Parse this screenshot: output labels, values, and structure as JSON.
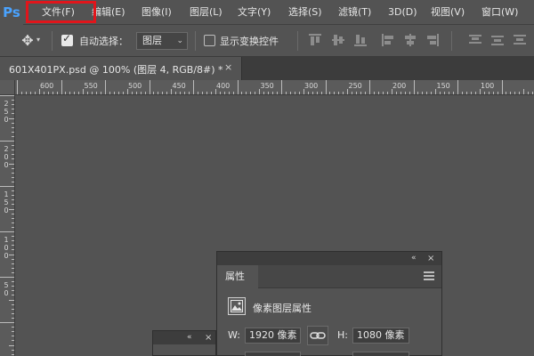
{
  "app": {
    "logo": "Ps"
  },
  "menubar": {
    "items": [
      {
        "label": "文件(F)"
      },
      {
        "label": "编辑(E)"
      },
      {
        "label": "图像(I)"
      },
      {
        "label": "图层(L)"
      },
      {
        "label": "文字(Y)"
      },
      {
        "label": "选择(S)"
      },
      {
        "label": "滤镜(T)"
      },
      {
        "label": "3D(D)"
      },
      {
        "label": "视图(V)"
      },
      {
        "label": "窗口(W)"
      }
    ],
    "highlight_color": "#e1151b"
  },
  "options": {
    "move_tool_icon": "move-icon",
    "auto_select_label": "自动选择：",
    "auto_select_checked": true,
    "target_select": "图层",
    "show_transform_label": "显示变换控件",
    "show_transform_checked": false
  },
  "document": {
    "tab_title": "601X401PX.psd @ 100% (图层 4, RGB/8#) *",
    "close_symbol": "×"
  },
  "rulers": {
    "top_labels": [
      "600",
      "550",
      "500",
      "450",
      "400",
      "350",
      "300",
      "250",
      "200",
      "150",
      "100"
    ],
    "left_labels": [
      "250",
      "200",
      "150",
      "100",
      "50"
    ]
  },
  "properties_panel": {
    "collapse_symbol": "«",
    "close_symbol": "×",
    "tab_label": "属性",
    "layer_type_label": "像素图层属性",
    "width_label": "W:",
    "width_value": "1920 像素",
    "height_label": "H:",
    "height_value": "1080 像素"
  },
  "mini_panel": {
    "collapse_symbol": "«",
    "close_symbol": "×"
  },
  "colors": {
    "background": "#535353",
    "accent_blue": "#4aa3ff",
    "highlight_red": "#e1151b"
  }
}
